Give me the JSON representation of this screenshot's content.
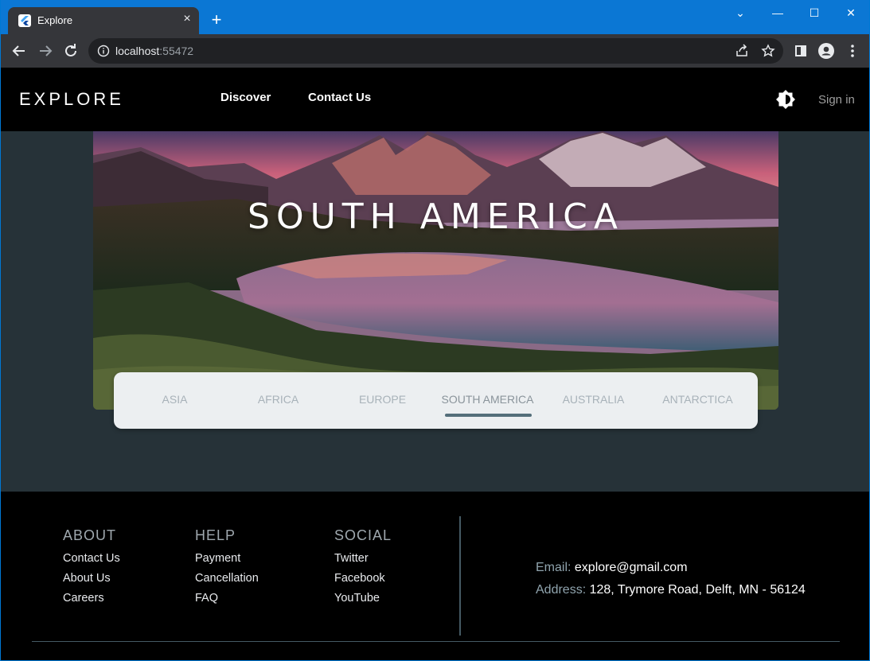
{
  "browser": {
    "tab_title": "Explore",
    "tab_close": "×",
    "new_tab": "+",
    "address_host": "localhost",
    "address_port": ":55472",
    "window_controls": [
      "⌄",
      "—",
      "☐",
      "✕"
    ]
  },
  "app": {
    "brand": "EXPLORE",
    "nav": [
      "Discover",
      "Contact Us"
    ],
    "sign_in": "Sign in"
  },
  "hero": {
    "title": "SOUTH AMERICA"
  },
  "continent_tabs": {
    "items": [
      "ASIA",
      "AFRICA",
      "EUROPE",
      "SOUTH AMERICA",
      "AUSTRALIA",
      "ANTARCTICA"
    ],
    "selected": "SOUTH AMERICA"
  },
  "footer": {
    "about": {
      "heading": "ABOUT",
      "links": [
        "Contact Us",
        "About Us",
        "Careers"
      ]
    },
    "help": {
      "heading": "HELP",
      "links": [
        "Payment",
        "Cancellation",
        "FAQ"
      ]
    },
    "social": {
      "heading": "SOCIAL",
      "links": [
        "Twitter",
        "Facebook",
        "YouTube"
      ]
    },
    "contact": {
      "email_label": "Email:",
      "email": "explore@gmail.com",
      "address_label": "Address:",
      "address": "128, Trymore Road, Delft, MN - 56124"
    }
  },
  "colors": {
    "page_bg": "#263238",
    "appbar_bg": "#000000",
    "tabbar_bg": "#eceff1",
    "tab_indicator": "#546e7a"
  }
}
